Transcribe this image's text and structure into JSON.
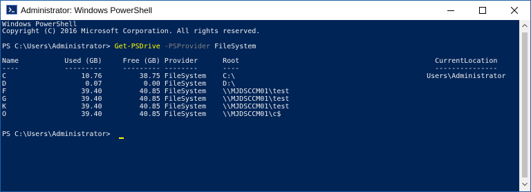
{
  "window": {
    "title": "Administrator: Windows PowerShell"
  },
  "icons": {
    "app": "powershell-icon",
    "minimize": "minimize-icon",
    "maximize": "maximize-icon",
    "close": "close-icon",
    "scroll_up": "chevron-up-icon",
    "scroll_down": "chevron-down-icon"
  },
  "colors": {
    "console_background": "#012456",
    "console_text": "#eeedf0",
    "command": "#ffff00",
    "parameter": "#808080"
  },
  "console": {
    "banner": [
      "Windows PowerShell",
      "Copyright (C) 2016 Microsoft Corporation. All rights reserved."
    ],
    "prompt1": {
      "prompt": "PS C:\\Users\\Administrator> ",
      "command": "Get-PSDrive",
      "parameter": " -PSProvider",
      "argument": " FileSystem"
    },
    "table": {
      "header": "Name           Used (GB)     Free (GB) Provider      Root                                               CurrentLocation",
      "separator": "----           ---------     --------- --------      ----                                               ---------------",
      "rows": [
        "C                  10.76         38.75 FileSystem    C:\\                                              Users\\Administrator",
        "D                   0.07          0.00 FileSystem    D:\\",
        "F                  39.40         40.85 FileSystem    \\\\MJDSCCM01\\test",
        "G                  39.40         40.85 FileSystem    \\\\MJDSCCM01\\test",
        "K                  39.40         40.85 FileSystem    \\\\MJDSCCM01\\test",
        "O                  39.40         40.85 FileSystem    \\\\MJDSCCM01\\c$"
      ]
    },
    "prompt2": "PS C:\\Users\\Administrator> "
  }
}
